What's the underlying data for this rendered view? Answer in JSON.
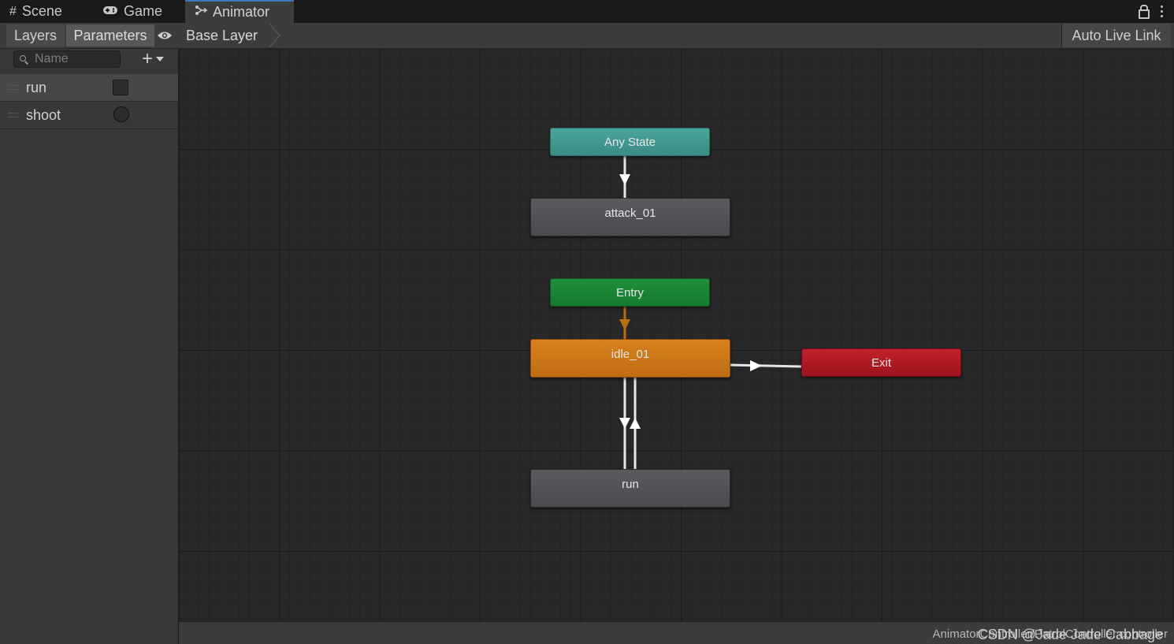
{
  "window": {
    "tabs": [
      {
        "label": "Scene",
        "icon": "grid-icon"
      },
      {
        "label": "Game",
        "icon": "gamepad-icon"
      },
      {
        "label": "Animator",
        "icon": "animator-icon",
        "active": true
      }
    ]
  },
  "toolbar": {
    "layers_tab": "Layers",
    "parameters_tab": "Parameters",
    "breadcrumb": "Base Layer",
    "auto_live_link": "Auto Live Link"
  },
  "parameters": {
    "search_placeholder": "Name",
    "items": [
      {
        "name": "run",
        "type": "bool",
        "selected": true
      },
      {
        "name": "shoot",
        "type": "trigger",
        "selected": false
      }
    ]
  },
  "graph": {
    "nodes": {
      "any_state": "Any State",
      "entry": "Entry",
      "exit": "Exit",
      "attack": "attack_01",
      "idle": "idle_01",
      "run": "run"
    },
    "colors": {
      "any_state": "#45a096",
      "entry": "#1c8a36",
      "exit": "#b31b24",
      "default_state": "#d47a1c",
      "state": "#525257",
      "default_transition": "#b8700f",
      "transition": "#e6e6e6"
    }
  },
  "status": {
    "path": "AnimatorController/PatrolController.controller"
  },
  "watermark": "CSDN @Jade Jade Cabbage"
}
